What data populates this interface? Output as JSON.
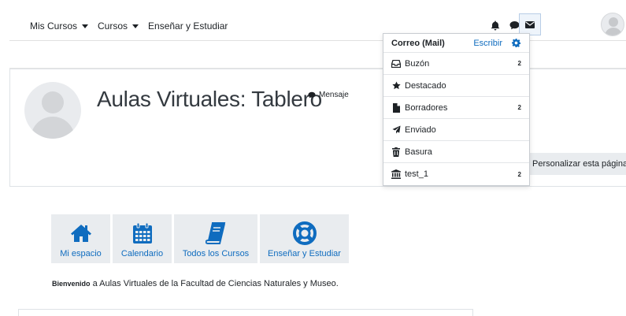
{
  "navbar": {
    "menu": [
      {
        "label": "Mis Cursos",
        "has_caret": true
      },
      {
        "label": "Cursos",
        "has_caret": true
      },
      {
        "label": "Enseñar y Estudiar",
        "has_caret": false
      }
    ],
    "icons": [
      "bell-icon",
      "chat-icon",
      "envelope-icon"
    ]
  },
  "header": {
    "title": "Aulas Virtuales: Tablero",
    "message_link": "Mensaje",
    "customize_button": "Personalizar esta página"
  },
  "tiles": [
    {
      "label": "Mi espacio",
      "icon": "home-icon"
    },
    {
      "label": "Calendario",
      "icon": "calendar-icon"
    },
    {
      "label": "Todos los Cursos",
      "icon": "book-icon"
    },
    {
      "label": "Enseñar y Estudiar",
      "icon": "lifebuoy-icon"
    }
  ],
  "welcome": {
    "bold": "Bienvenido",
    "text": " a Aulas Virtuales de la Facultad de Ciencias Naturales y Museo."
  },
  "mail_popover": {
    "title": "Correo (Mail)",
    "write_label": "Escribir",
    "items": [
      {
        "label": "Buzón",
        "count": "2",
        "icon": "inbox-icon"
      },
      {
        "label": "Destacado",
        "count": "",
        "icon": "star-icon"
      },
      {
        "label": "Borradores",
        "count": "2",
        "icon": "file-icon"
      },
      {
        "label": "Enviado",
        "count": "",
        "icon": "paper-plane-icon"
      },
      {
        "label": "Basura",
        "count": "",
        "icon": "trash-icon"
      },
      {
        "label": "test_1",
        "count": "2",
        "icon": "institution-icon"
      }
    ]
  },
  "colors": {
    "link": "#0f6cbf",
    "tile_bg": "#e9ecef",
    "text": "#1d2125"
  }
}
